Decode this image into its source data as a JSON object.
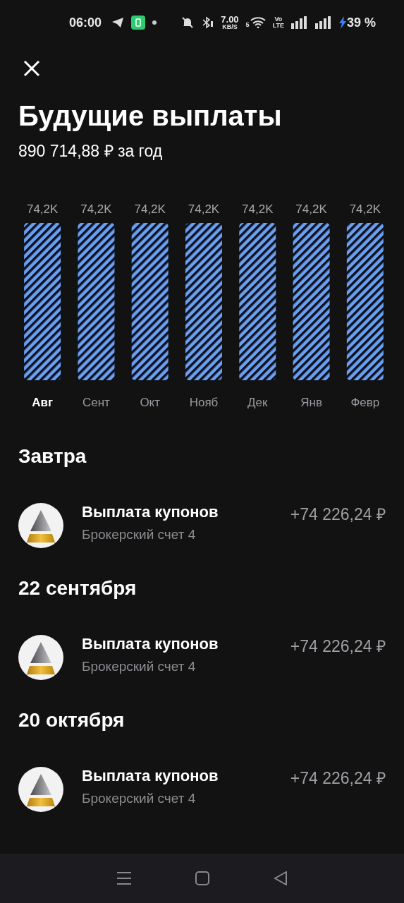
{
  "status_bar": {
    "time": "06:00",
    "speed_value": "7.00",
    "speed_unit": "KB/S",
    "wifi_band": "5",
    "volte_top": "Vo",
    "volte_bottom": "LTE",
    "battery": "39 %"
  },
  "header": {
    "title": "Будущие выплаты",
    "subtitle": "890 714,88 ₽ за год"
  },
  "chart": {
    "category_selected": [
      true,
      false,
      false,
      false,
      false,
      false,
      false
    ],
    "chart_data": {
      "type": "bar",
      "categories": [
        "Авг",
        "Сент",
        "Окт",
        "Нояб",
        "Дек",
        "Янв",
        "Февр"
      ],
      "values": [
        74.2,
        74.2,
        74.2,
        74.2,
        74.2,
        74.2,
        74.2
      ],
      "ylim": [
        0,
        74.2
      ],
      "value_labels": [
        "74,2K",
        "74,2K",
        "74,2K",
        "74,2K",
        "74,2K",
        "74,2K",
        "74,2K"
      ]
    }
  },
  "sections": [
    {
      "heading": "Завтра",
      "items": [
        {
          "title": "Выплата купонов",
          "account": "Брокерский счет 4",
          "amount": "+74 226,24 ₽"
        }
      ]
    },
    {
      "heading": "22 сентября",
      "items": [
        {
          "title": "Выплата купонов",
          "account": "Брокерский счет 4",
          "amount": "+74 226,24 ₽"
        }
      ]
    },
    {
      "heading": "20 октября",
      "items": [
        {
          "title": "Выплата купонов",
          "account": "Брокерский счет 4",
          "amount": "+74 226,24 ₽"
        }
      ]
    }
  ]
}
